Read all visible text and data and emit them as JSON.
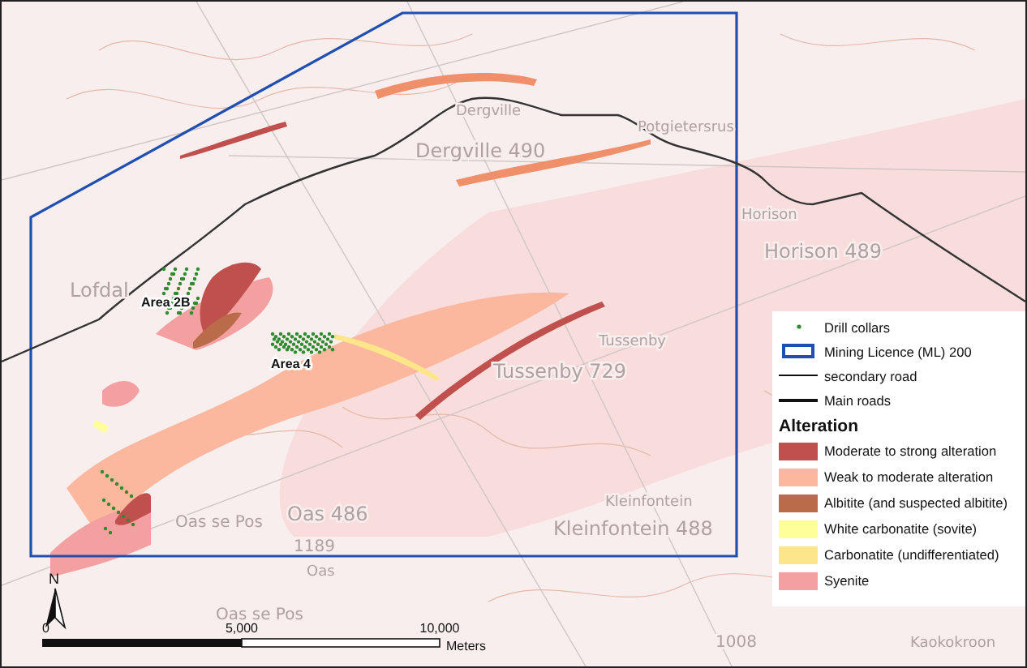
{
  "map": {
    "place_labels": [
      {
        "text": "Dergville"
      },
      {
        "text": "Potgietersrus"
      },
      {
        "text": "Dergville 490"
      },
      {
        "text": "Horison"
      },
      {
        "text": "Horison 489"
      },
      {
        "text": "Lofdal"
      },
      {
        "text": "Tussenby"
      },
      {
        "text": "Tussenby 729"
      },
      {
        "text": "Kleinfontein"
      },
      {
        "text": "Oas se Pos"
      },
      {
        "text": "Oas 486"
      },
      {
        "text": "Kleinfontein 488"
      },
      {
        "text": "1189"
      },
      {
        "text": "Oas"
      },
      {
        "text": "Oas se Pos"
      },
      {
        "text": "1008"
      },
      {
        "text": "Kaokokroon"
      }
    ],
    "area_labels": [
      {
        "text": "Area 2B"
      },
      {
        "text": "Area 4"
      }
    ],
    "north_label": "N",
    "scale_bar": {
      "ticks": [
        "0",
        "5,000",
        "10,000"
      ],
      "unit": "Meters"
    }
  },
  "legend": {
    "symbols": [
      {
        "kind": "point",
        "label": "Drill collars"
      },
      {
        "kind": "outline",
        "label": "Mining Licence (ML) 200"
      },
      {
        "kind": "thin-line",
        "label": "secondary road"
      },
      {
        "kind": "thick-line",
        "label": "Main roads"
      }
    ],
    "title": "Alteration",
    "units": [
      {
        "label": "Moderate to strong alteration",
        "color": "#c0504d"
      },
      {
        "label": "Weak to moderate alteration",
        "color": "#fbb89e"
      },
      {
        "label": "Albitite (and suspected albitite)",
        "color": "#b96b4a"
      },
      {
        "label": "White carbonatite (sovite)",
        "color": "#ffff99"
      },
      {
        "label": "Carbonatite (undifferentiated)",
        "color": "#fde68a"
      },
      {
        "label": "Syenite",
        "color": "#f4a0a0"
      }
    ]
  }
}
